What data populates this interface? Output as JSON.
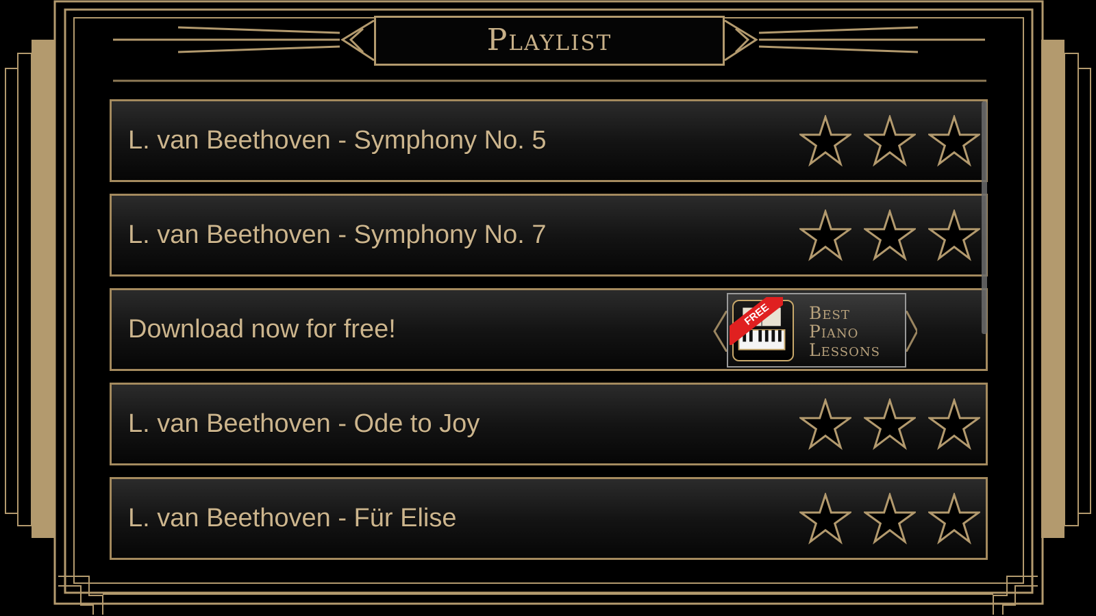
{
  "header": {
    "title": "Playlist"
  },
  "playlist": {
    "items": [
      {
        "title": "L. van Beethoven - Symphony No. 5",
        "stars_filled": 0,
        "stars_total": 3
      },
      {
        "title": "L. van Beethoven - Symphony No. 7",
        "stars_filled": 0,
        "stars_total": 3
      },
      {
        "title": "Download now for free!"
      },
      {
        "title": "L. van Beethoven - Ode to Joy",
        "stars_filled": 0,
        "stars_total": 3
      },
      {
        "title": "L. van Beethoven - Für Elise",
        "stars_filled": 0,
        "stars_total": 3
      }
    ]
  },
  "ad": {
    "ribbon": "FREE",
    "line1": "Best",
    "line2": "Piano",
    "line3": "Lessons"
  },
  "colors": {
    "gold": "#b39a6e",
    "text_gold": "#ccb58d",
    "ribbon_red": "#e02020"
  }
}
